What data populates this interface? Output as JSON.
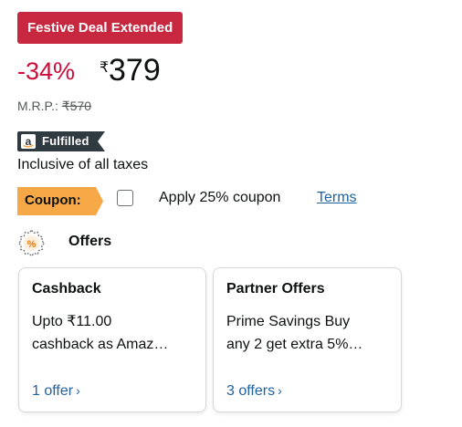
{
  "deal_badge": "Festive Deal Extended",
  "price": {
    "discount": "-34%",
    "currency": "₹",
    "amount": "379"
  },
  "mrp": {
    "label": "M.R.P.:",
    "value": "₹570"
  },
  "fulfilled": {
    "logo_letter": "a",
    "label": "Fulfilled"
  },
  "taxes_text": "Inclusive of all taxes",
  "coupon": {
    "tag": "Coupon:",
    "checked": false,
    "text": "Apply 25% coupon",
    "terms_link": "Terms"
  },
  "offers": {
    "icon": "percent-badge-icon",
    "title": "Offers",
    "cards": [
      {
        "title": "Cashback",
        "line1": "Upto ₹11.00",
        "line2": "cashback as Amaz…",
        "link": "1 offer",
        "chevron": "›"
      },
      {
        "title": "Partner Offers",
        "line1": "Prime Savings Buy",
        "line2": "any 2 get extra 5%…",
        "link": "3 offers",
        "chevron": "›"
      }
    ]
  },
  "colors": {
    "deal_red": "#c7283f",
    "discount_red": "#cc0c39",
    "coupon_orange": "#f7a846",
    "link_blue": "#2162a1",
    "fulfilled_dark": "#2f3a41"
  }
}
